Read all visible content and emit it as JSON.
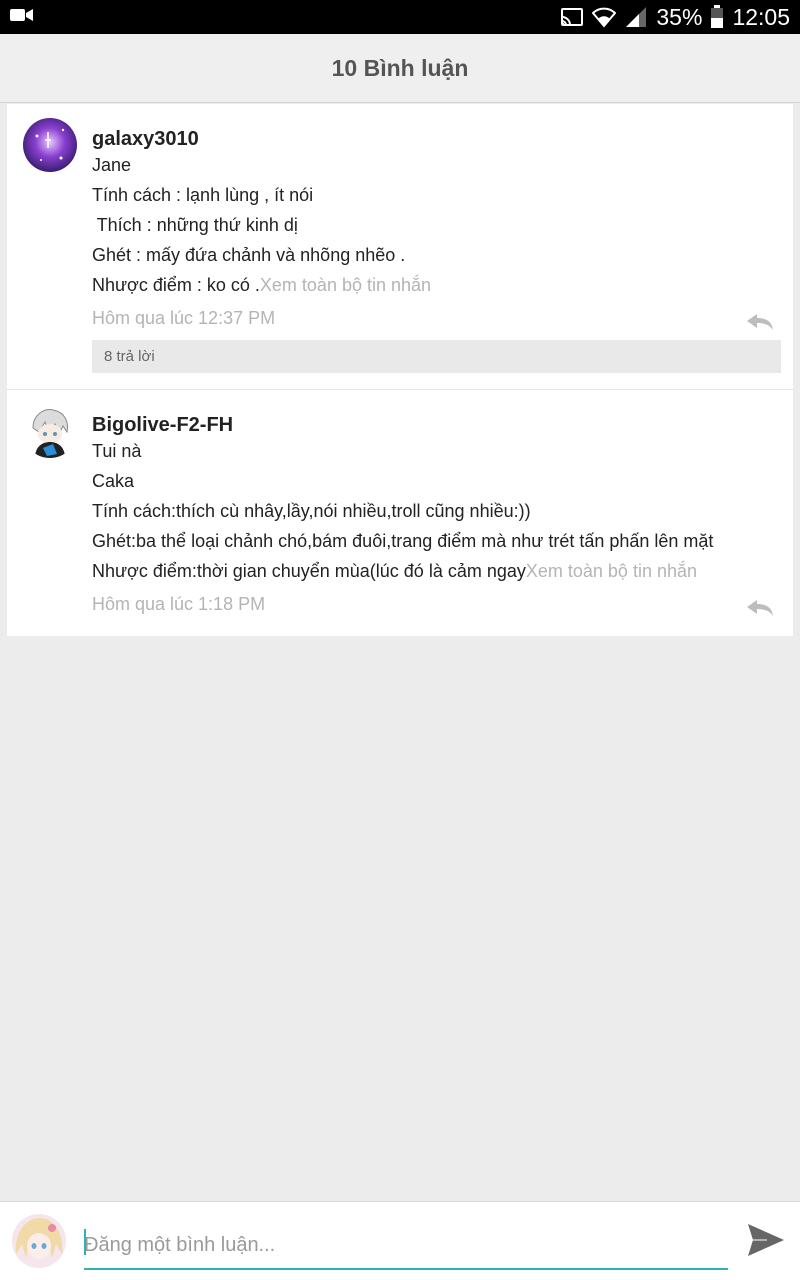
{
  "status_bar": {
    "battery": "35%",
    "time": "12:05"
  },
  "header": {
    "title": "10 Bình luận"
  },
  "comments": [
    {
      "username": "galaxy3010",
      "lines": [
        "Jane",
        "Tính cách : lạnh lùng , ít nói",
        " Thích : những thứ kinh dị",
        "Ghét : mấy đứa chảnh và nhõng nhẽo .",
        "Nhược điểm : ko có ."
      ],
      "see_all": "Xem toàn bộ tin nhắn",
      "time": "Hôm qua lúc 12:37 PM",
      "replies": "8 trả lời"
    },
    {
      "username": "Bigolive-F2-FH",
      "lines": [
        "Tui nà",
        "Caka",
        "Tính cách:thích cù nhây,lầy,nói nhiều,troll cũng nhiều:))",
        "Ghét:ba thể loại chảnh chó,bám đuôi,trang điểm mà như trét tấn phấn lên mặt",
        "Nhược điểm:thời gian chuyển mùa(lúc đó là cảm ngay"
      ],
      "see_all": "Xem toàn bộ tin nhắn",
      "time": "Hôm qua lúc 1:18 PM"
    }
  ],
  "compose": {
    "placeholder": "Đăng một bình luận..."
  },
  "icons": {
    "video": "video-camera-icon",
    "cast": "cast-icon",
    "wifi": "wifi-icon",
    "signal": "signal-icon",
    "battery": "battery-icon",
    "reply": "reply-icon",
    "send": "send-icon"
  },
  "colors": {
    "accent": "#2bb5b0",
    "muted_text": "#b4b4b4"
  }
}
